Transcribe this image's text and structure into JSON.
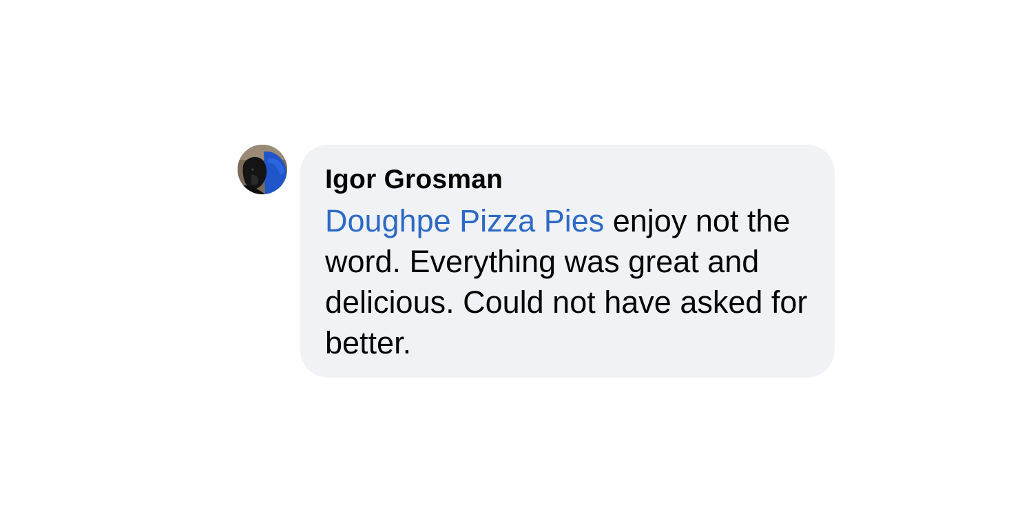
{
  "comment": {
    "author": "Igor Grosman",
    "mention": "Doughpe Pizza Pies",
    "text": " enjoy not the word. Everything was great and delicious. Could not have asked for better."
  },
  "colors": {
    "bubble_bg": "#f0f2f5",
    "mention": "#2d6ac4",
    "text": "#050505"
  },
  "icons": {
    "avatar": "profile-photo-icon"
  }
}
